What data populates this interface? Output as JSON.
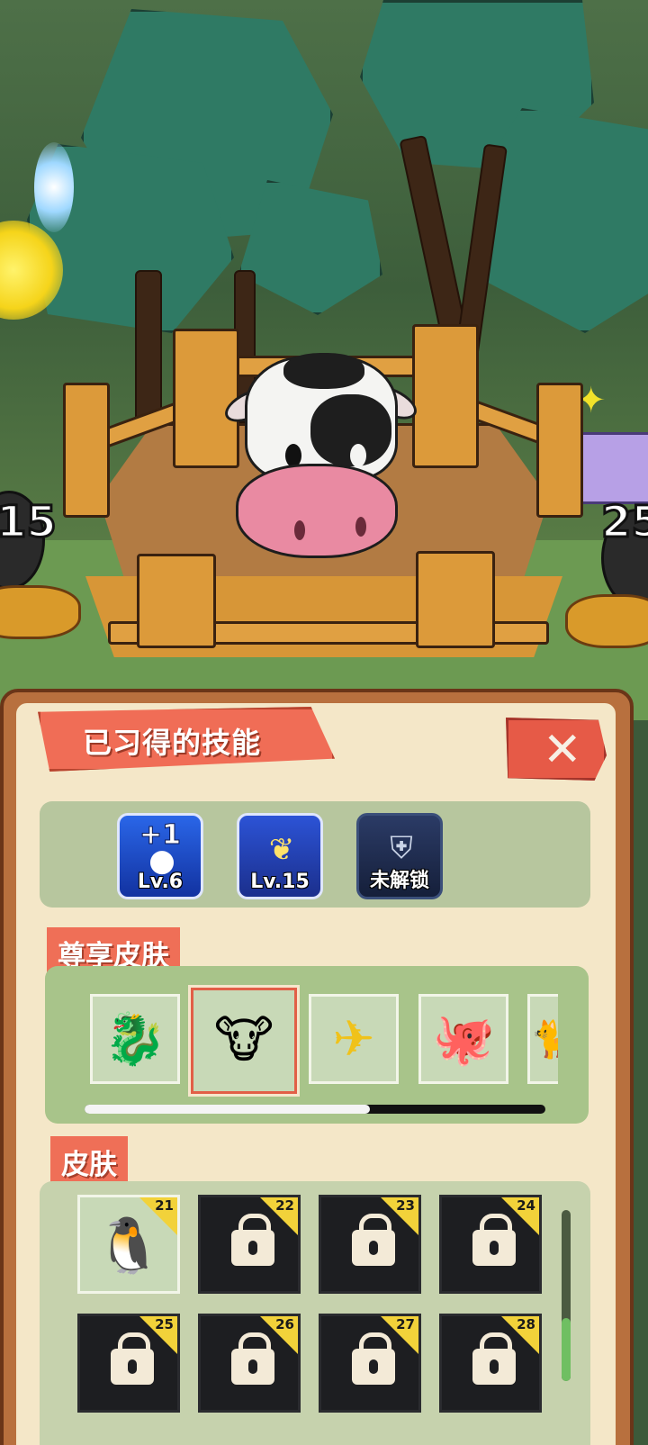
{
  "scene": {
    "left_counter": "15",
    "right_counter": "25"
  },
  "panel": {
    "title": "已习得的技能"
  },
  "skills": [
    {
      "name": "extra-life",
      "top": "+1",
      "level": "Lv.6"
    },
    {
      "name": "wings",
      "level": "Lv.15"
    },
    {
      "name": "locked",
      "level": "未解锁"
    }
  ],
  "premium": {
    "header": "尊享皮肤",
    "items": [
      "dragon",
      "cow",
      "drone",
      "octopus",
      "cat"
    ],
    "selected": "cow",
    "scroll_fraction": 0.62
  },
  "skins": {
    "header": "皮肤",
    "items": [
      {
        "num": "21",
        "locked": false,
        "icon": "penguin-on-slime-icon"
      },
      {
        "num": "22",
        "locked": true
      },
      {
        "num": "23",
        "locked": true
      },
      {
        "num": "24",
        "locked": true
      },
      {
        "num": "25",
        "locked": true
      },
      {
        "num": "26",
        "locked": true
      },
      {
        "num": "27",
        "locked": true
      },
      {
        "num": "28",
        "locked": true
      }
    ]
  },
  "colors": {
    "accent": "#ef6f57",
    "panel_bg": "#f4e7c8",
    "corner_badge": "#f2d23a"
  }
}
